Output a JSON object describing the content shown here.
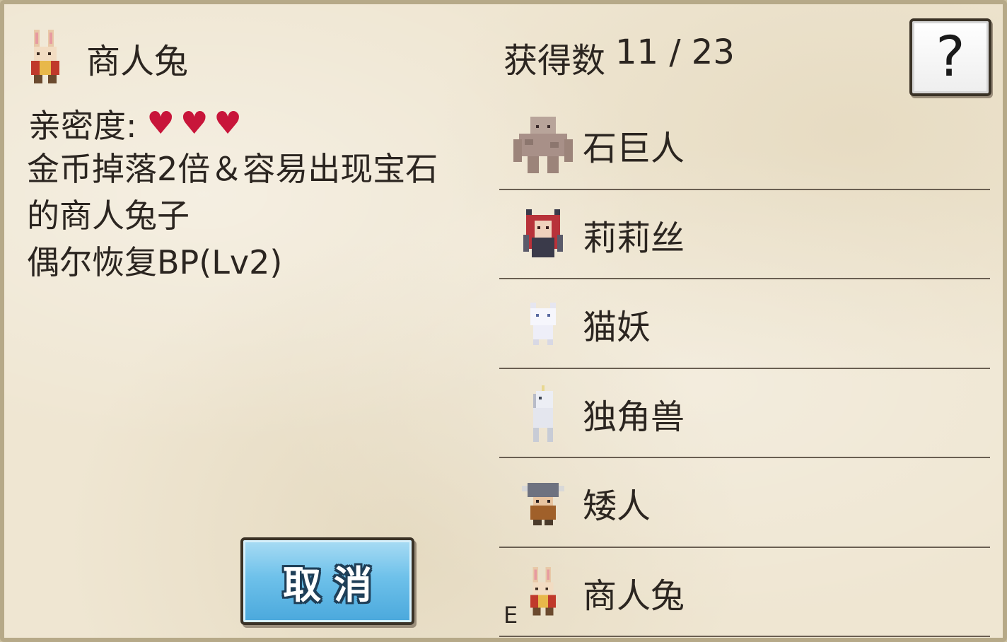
{
  "detail": {
    "name": "商人兔",
    "sprite_icon": "bunny-merchant-icon",
    "affinity_label": "亲密度:",
    "affinity_level": 3,
    "heart_symbol": "♥",
    "heart_color": "#c8153a",
    "description_lines": [
      "金币掉落2倍＆容易出现宝石",
      "的商人兔子",
      "偶尔恢复BP(Lv2)"
    ]
  },
  "cancel_button": {
    "label": "取消"
  },
  "collection": {
    "label": "获得数",
    "value": "11 / 23"
  },
  "help_button": {
    "glyph": "?"
  },
  "monsters": [
    {
      "name": "石巨人",
      "icon": "stone-golem-icon",
      "equipped": ""
    },
    {
      "name": "莉莉丝",
      "icon": "lilith-icon",
      "equipped": ""
    },
    {
      "name": "猫妖",
      "icon": "cat-spirit-icon",
      "equipped": ""
    },
    {
      "name": "独角兽",
      "icon": "unicorn-icon",
      "equipped": ""
    },
    {
      "name": "矮人",
      "icon": "dwarf-icon",
      "equipped": ""
    },
    {
      "name": "商人兔",
      "icon": "bunny-merchant-icon",
      "equipped": "E"
    }
  ],
  "colors": {
    "panel_bg": "#efe6d2",
    "button_blue": "#6ec1ea",
    "divider": "#6a5f52"
  }
}
